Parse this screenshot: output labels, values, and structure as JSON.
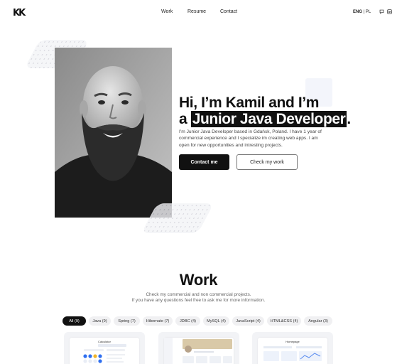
{
  "header": {
    "logo": "KK",
    "nav": [
      "Work",
      "Resume",
      "Contact"
    ],
    "lang_active": "ENG",
    "lang_separator": "|",
    "lang_other": "PL",
    "icons": [
      "chat-icon",
      "linkedin-icon"
    ]
  },
  "hero": {
    "title_line1": "Hi, I’m Kamil and I’m",
    "title_prefix": "a",
    "title_highlight": "Junior Java Developer",
    "title_suffix": ".",
    "description": "I’m Junior Java Developer based in Gdańsk, Poland. I have 1 year of commercial experience and I specialize im creating web apps. I am open for new opportunities and intresting projects.",
    "cta_primary": "Contact me",
    "cta_secondary": "Check my work"
  },
  "work": {
    "title": "Work",
    "subtitle_line1": "Check my commercial and non commercial projects.",
    "subtitle_line2": "If you have any questions feel free to ask me for more information.",
    "filters": [
      {
        "label": "All (9)",
        "active": true
      },
      {
        "label": "Java (9)",
        "active": false
      },
      {
        "label": "Spring (7)",
        "active": false
      },
      {
        "label": "Hibernate (7)",
        "active": false
      },
      {
        "label": "JDBC (4)",
        "active": false
      },
      {
        "label": "MySQL (4)",
        "active": false
      },
      {
        "label": "JavaScript (4)",
        "active": false
      },
      {
        "label": "HTML&CSS (4)",
        "active": false
      },
      {
        "label": "Angular (3)",
        "active": false
      }
    ],
    "cards": [
      {
        "preview_title": "Calculator"
      },
      {
        "preview_title": ""
      },
      {
        "preview_title": "Homepage"
      }
    ]
  },
  "colors": {
    "text": "#111111",
    "accent_dark": "#111111",
    "chip_bg": "#f0f0f2",
    "card_bg": "#f2f3f6"
  }
}
